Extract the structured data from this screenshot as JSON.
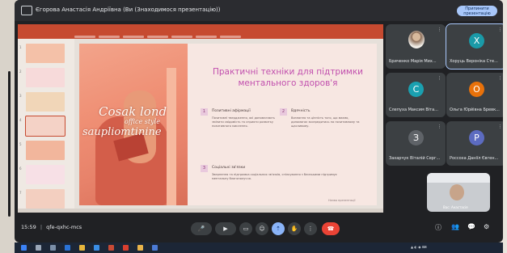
{
  "window": {
    "title": "Єгорова Анастасія Андріївна (Ви (Знаходимося презентацію))",
    "stop_button": "Припинити презентацію"
  },
  "slide": {
    "title": "Практичні техніки для підтримки ментального здоров'я",
    "image_script_1": "Сosak lond",
    "image_script_2": "office style",
    "image_script_3": "saupliomtinine",
    "points": [
      {
        "num": "1",
        "heading": "Позитивні афірмації",
        "text": "Позитивні твердження, які допомагають змінити свідомість та сприяти розвитку позитивного мислення."
      },
      {
        "num": "2",
        "heading": "Вдячність",
        "text": "Визнання та цінність того, що маємо, допомагає зосередитись на позитивному та щасливому."
      },
      {
        "num": "3",
        "heading": "Соціальні зв'язки",
        "text": "Звернення та підтримка соціальних зв'язків, спілкування з близькими підтримує ментальну благополуччя."
      }
    ],
    "footer": "Назва презентації"
  },
  "thumbnails": [
    {
      "num": "1",
      "color": "#f4c1a8"
    },
    {
      "num": "2",
      "color": "#f7dada"
    },
    {
      "num": "3",
      "color": "#f1d6b8"
    },
    {
      "num": "4",
      "color": "#f4d2c6"
    },
    {
      "num": "5",
      "color": "#f2b69c"
    },
    {
      "num": "6",
      "color": "#f7e0e6"
    },
    {
      "num": "7",
      "color": "#f3cfc0"
    }
  ],
  "participants": [
    {
      "name": "Бриченко Марія Мих...",
      "initial": "",
      "color": "",
      "photo": true
    },
    {
      "name": "Хоруць Вероніка Сте...",
      "initial": "Х",
      "color": "#1a9aa8",
      "photo": false,
      "active": true
    },
    {
      "name": "Слепуха Максим Віта...",
      "initial": "С",
      "color": "#1aa0b0",
      "photo": false
    },
    {
      "name": "Ольга Юрйівна Бревк...",
      "initial": "О",
      "color": "#e8710a",
      "photo": false
    },
    {
      "name": "Захарчук Віталій Серг...",
      "initial": "З",
      "color": "#5f6368",
      "photo": false
    },
    {
      "name": "Россоха Даніїл Євген...",
      "initial": "Р",
      "color": "#5c6bc0",
      "photo": false
    }
  ],
  "self_view": {
    "name": "Вас: Анастасія"
  },
  "controls": {
    "time": "15:59",
    "meeting_code": "qfe-qxhc-mcs",
    "separator": "|"
  },
  "colors": {
    "accent": "#a8c7fa",
    "end_call": "#ea4335",
    "slide_title": "#c14fae",
    "ribbon": "#c64a30"
  }
}
